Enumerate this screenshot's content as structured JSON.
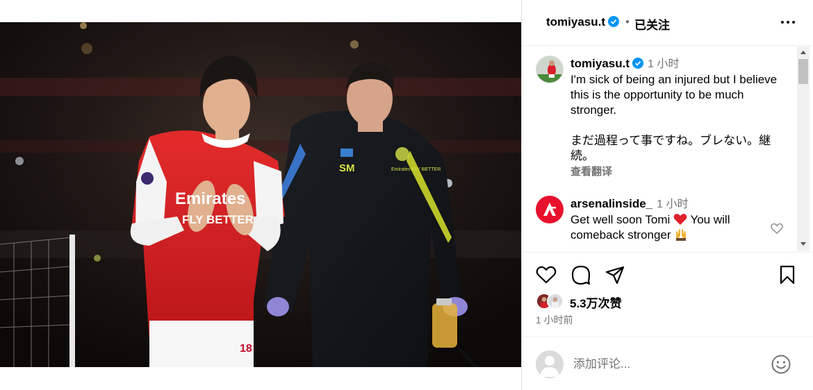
{
  "header": {
    "username": "tomiyasu.t",
    "separator": "•",
    "follow_status": "已关注"
  },
  "caption": {
    "username": "tomiyasu.t",
    "time": "1 小时",
    "text": "I'm sick of being an injured but I believe this is the opportunity to be much stronger.\n\nまだ過程って事ですね。ブレない。継続。",
    "translate_label": "查看翻译"
  },
  "comments": [
    {
      "username": "arsenalinside_",
      "time": "1 小时",
      "text_before": "Get well soon Tomi ",
      "text_after": " You will comeback stronger ",
      "emoji_1": "red-heart",
      "emoji_2": "raising-hands"
    }
  ],
  "likes": {
    "text": "5.3万次赞"
  },
  "post_time": "1 小时前",
  "add_comment": {
    "placeholder": "添加评论..."
  },
  "photo": {
    "jersey_text_1": "Emirates",
    "jersey_text_2": "FLY BETTER",
    "staff_initials": "SM",
    "staff_badge": "Emirates FLY BETTER",
    "shorts_number": "18"
  },
  "colors": {
    "verified_blue": "#0095f6",
    "arsenal_red": "#e8112d",
    "muted_text": "#737373"
  },
  "icons": [
    "verified-badge-icon",
    "more-options-icon",
    "like-heart-icon",
    "comment-icon",
    "share-icon",
    "save-bookmark-icon",
    "emoji-icon",
    "comment-like-heart-icon"
  ]
}
